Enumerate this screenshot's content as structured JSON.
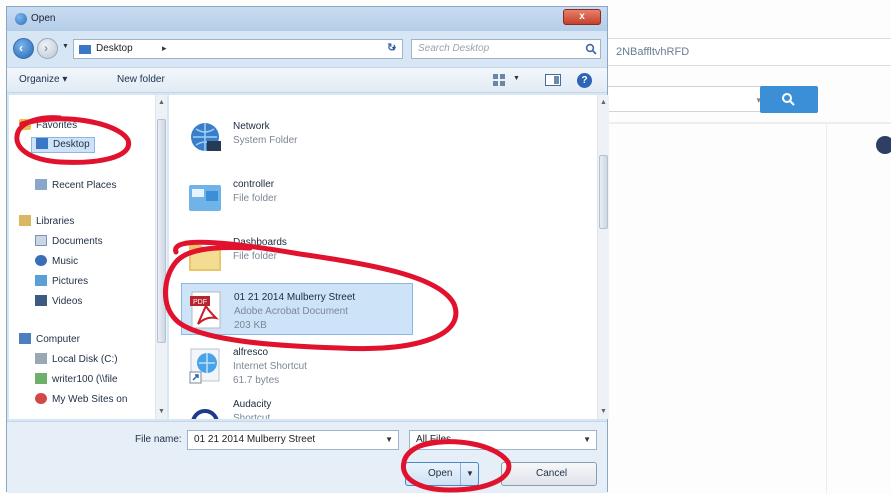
{
  "background_page": {
    "url_fragment": "2NBaffltvhRFD",
    "colors": {
      "search_button": "#3b8fd6",
      "badge": "#2f3f63"
    }
  },
  "dialog": {
    "title": "Open",
    "close_label": "x",
    "address": {
      "segment": "Desktop",
      "dropdown": "▾"
    },
    "search_placeholder": "Search Desktop",
    "toolbar": {
      "organize": "Organize ▾",
      "new_folder": "New folder"
    },
    "nav_pane": {
      "favorites": "Favorites",
      "desktop": "Desktop",
      "recent_places": "Recent Places",
      "libraries": "Libraries",
      "documents": "Documents",
      "music": "Music",
      "pictures": "Pictures",
      "videos": "Videos",
      "computer": "Computer",
      "local_disk": "Local Disk (C:)",
      "network_drive": "writer100 (\\\\file",
      "web_sites": "My Web Sites on"
    },
    "files": [
      {
        "name": "Network",
        "type": "System Folder",
        "size": "",
        "icon": "network-icon"
      },
      {
        "name": "controller",
        "type": "File folder",
        "size": "",
        "icon": "folder-icon"
      },
      {
        "name": "Dashboards",
        "type": "File folder",
        "size": "",
        "icon": "folder-icon"
      },
      {
        "name": "01 21 2014 Mulberry Street",
        "type": "Adobe Acrobat Document",
        "size": "203 KB",
        "icon": "pdf-icon"
      },
      {
        "name": "alfresco",
        "type": "Internet Shortcut",
        "size": "61.7 bytes",
        "icon": "internet-shortcut-icon"
      },
      {
        "name": "Audacity",
        "type": "Shortcut",
        "size": "",
        "icon": "headphones-icon"
      }
    ],
    "bottom": {
      "file_name_label": "File name:",
      "file_name_value": "01 21 2014 Mulberry Street",
      "file_type": "All Files",
      "open_label": "Open",
      "cancel_label": "Cancel"
    },
    "colors": {
      "annotation": "#e0122e",
      "selection": "#cde3f8",
      "title_bar": "#b4cde8"
    }
  }
}
